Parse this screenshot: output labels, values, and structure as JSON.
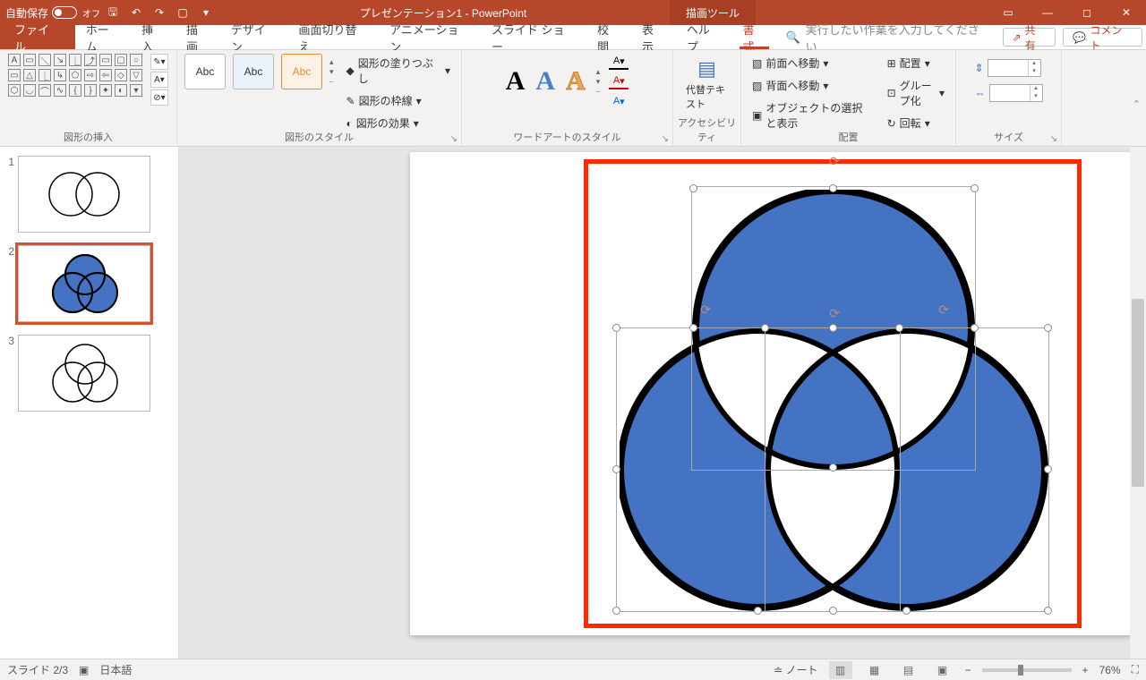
{
  "titlebar": {
    "autosave_label": "自動保存",
    "autosave_state": "オフ",
    "doc_title": "プレゼンテーション1 - PowerPoint",
    "tools_tab": "描画ツール"
  },
  "tabs": {
    "file": "ファイル",
    "home": "ホーム",
    "insert": "挿入",
    "draw": "描画",
    "design": "デザイン",
    "transitions": "画面切り替え",
    "animations": "アニメーション",
    "slideshow": "スライド ショー",
    "review": "校閲",
    "view": "表示",
    "help": "ヘルプ",
    "format": "書式",
    "search_placeholder": "実行したい作業を入力してください",
    "share": "共有",
    "comments": "コメント"
  },
  "ribbon": {
    "insert_shapes": "図形の挿入",
    "shape_styles": "図形のスタイル",
    "style_sample": "Abc",
    "shape_fill": "図形の塗りつぶし",
    "shape_outline": "図形の枠線",
    "shape_effects": "図形の効果",
    "wordart_styles": "ワードアートのスタイル",
    "wa_sample": "A",
    "text_fill_letter": "A",
    "accessibility": "アクセシビリティ",
    "alt_text": "代替テキスト",
    "arrange": "配置",
    "bring_forward": "前面へ移動",
    "send_backward": "背面へ移動",
    "selection_pane": "オブジェクトの選択と表示",
    "align": "配置",
    "group": "グループ化",
    "rotate": "回転",
    "size": "サイズ",
    "height": "",
    "width": ""
  },
  "thumbs": [
    "1",
    "2",
    "3"
  ],
  "status": {
    "slide": "スライド 2/3",
    "lang": "日本語",
    "notes": "ノート",
    "zoom": "76%"
  }
}
